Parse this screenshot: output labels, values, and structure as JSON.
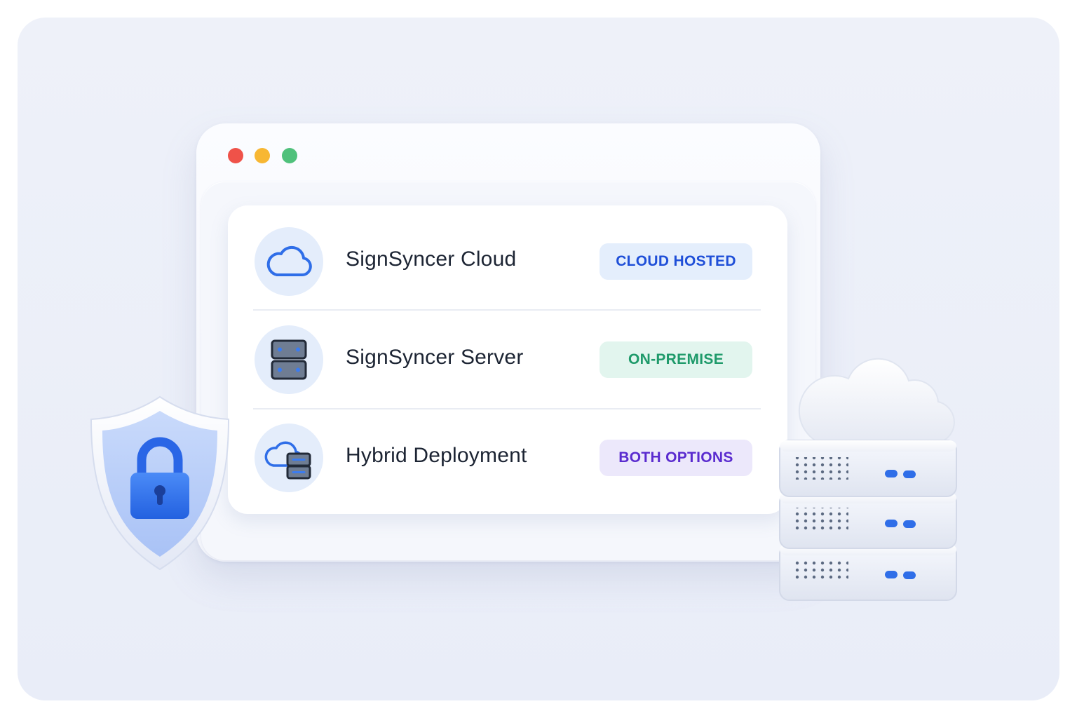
{
  "window": {
    "controls": [
      {
        "name": "close",
        "color": "#ef5249"
      },
      {
        "name": "minimize",
        "color": "#f7b733"
      },
      {
        "name": "maximize",
        "color": "#4fc17b"
      }
    ]
  },
  "deployments": [
    {
      "title": "SignSyncer Cloud",
      "badge": "CLOUD HOSTED",
      "icon": "cloud-icon",
      "badge_text_color": "#1f4fd8",
      "badge_bg": "#e4eefc"
    },
    {
      "title": "SignSyncer Server",
      "badge": "ON-PREMISE",
      "icon": "server-icon",
      "badge_text_color": "#1e9a6a",
      "badge_bg": "#e2f5ee"
    },
    {
      "title": "Hybrid Deployment",
      "badge": "BOTH OPTIONS",
      "icon": "hybrid-cloud-server-icon",
      "badge_text_color": "#5a2bcf",
      "badge_bg": "#ece8fb"
    }
  ],
  "illustrations": {
    "left": "shield-lock-icon",
    "right": "server-rack-cloud-icon"
  },
  "colors": {
    "accent_blue": "#2f6ee8",
    "background": "#edf0f8"
  }
}
